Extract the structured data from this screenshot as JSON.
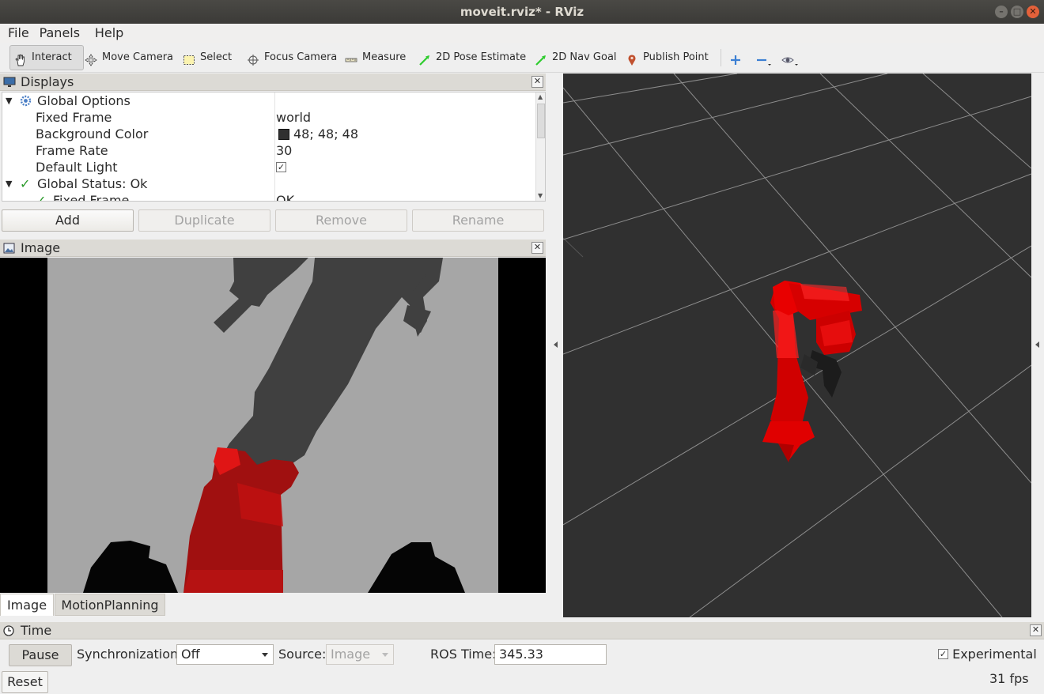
{
  "window": {
    "title": "moveit.rviz* - RViz"
  },
  "menu": {
    "items": [
      "File",
      "Panels",
      "Help"
    ]
  },
  "toolbar": {
    "tools": [
      {
        "label": "Interact",
        "icon": "hand-icon"
      },
      {
        "label": "Move Camera",
        "icon": "move-camera-icon"
      },
      {
        "label": "Select",
        "icon": "select-icon"
      },
      {
        "label": "Focus Camera",
        "icon": "focus-camera-icon"
      },
      {
        "label": "Measure",
        "icon": "measure-icon"
      },
      {
        "label": "2D Pose Estimate",
        "icon": "pose-arrow-icon"
      },
      {
        "label": "2D Nav Goal",
        "icon": "nav-goal-arrow-icon"
      },
      {
        "label": "Publish Point",
        "icon": "map-pin-icon"
      }
    ]
  },
  "displays": {
    "title": "Displays",
    "rows": [
      {
        "key": "Global Options",
        "value": ""
      },
      {
        "key": "Fixed Frame",
        "value": "world"
      },
      {
        "key": "Background Color",
        "value": "48; 48; 48"
      },
      {
        "key": "Frame Rate",
        "value": "30"
      },
      {
        "key": "Default Light",
        "value": "✓"
      },
      {
        "key": "Global Status: Ok",
        "value": ""
      },
      {
        "key": "Fixed Frame",
        "value": "OK"
      }
    ],
    "buttons": {
      "add": "Add",
      "duplicate": "Duplicate",
      "remove": "Remove",
      "rename": "Rename"
    },
    "background_color": "#303030"
  },
  "image_panel": {
    "title": "Image"
  },
  "tabs": [
    "Image",
    "MotionPlanning"
  ],
  "time": {
    "title": "Time",
    "pause": "Pause",
    "sync_label": "Synchronization:",
    "sync_value": "Off",
    "source_label": "Source:",
    "source_value": "Image",
    "ros_time_label": "ROS Time:",
    "ros_time_value": "345.33",
    "experimental_label": "Experimental",
    "reset": "Reset",
    "fps": "31 fps"
  },
  "colors": {
    "robot": "#cc0000",
    "view_bg": "#303030",
    "grid": "#a0a0a0"
  }
}
